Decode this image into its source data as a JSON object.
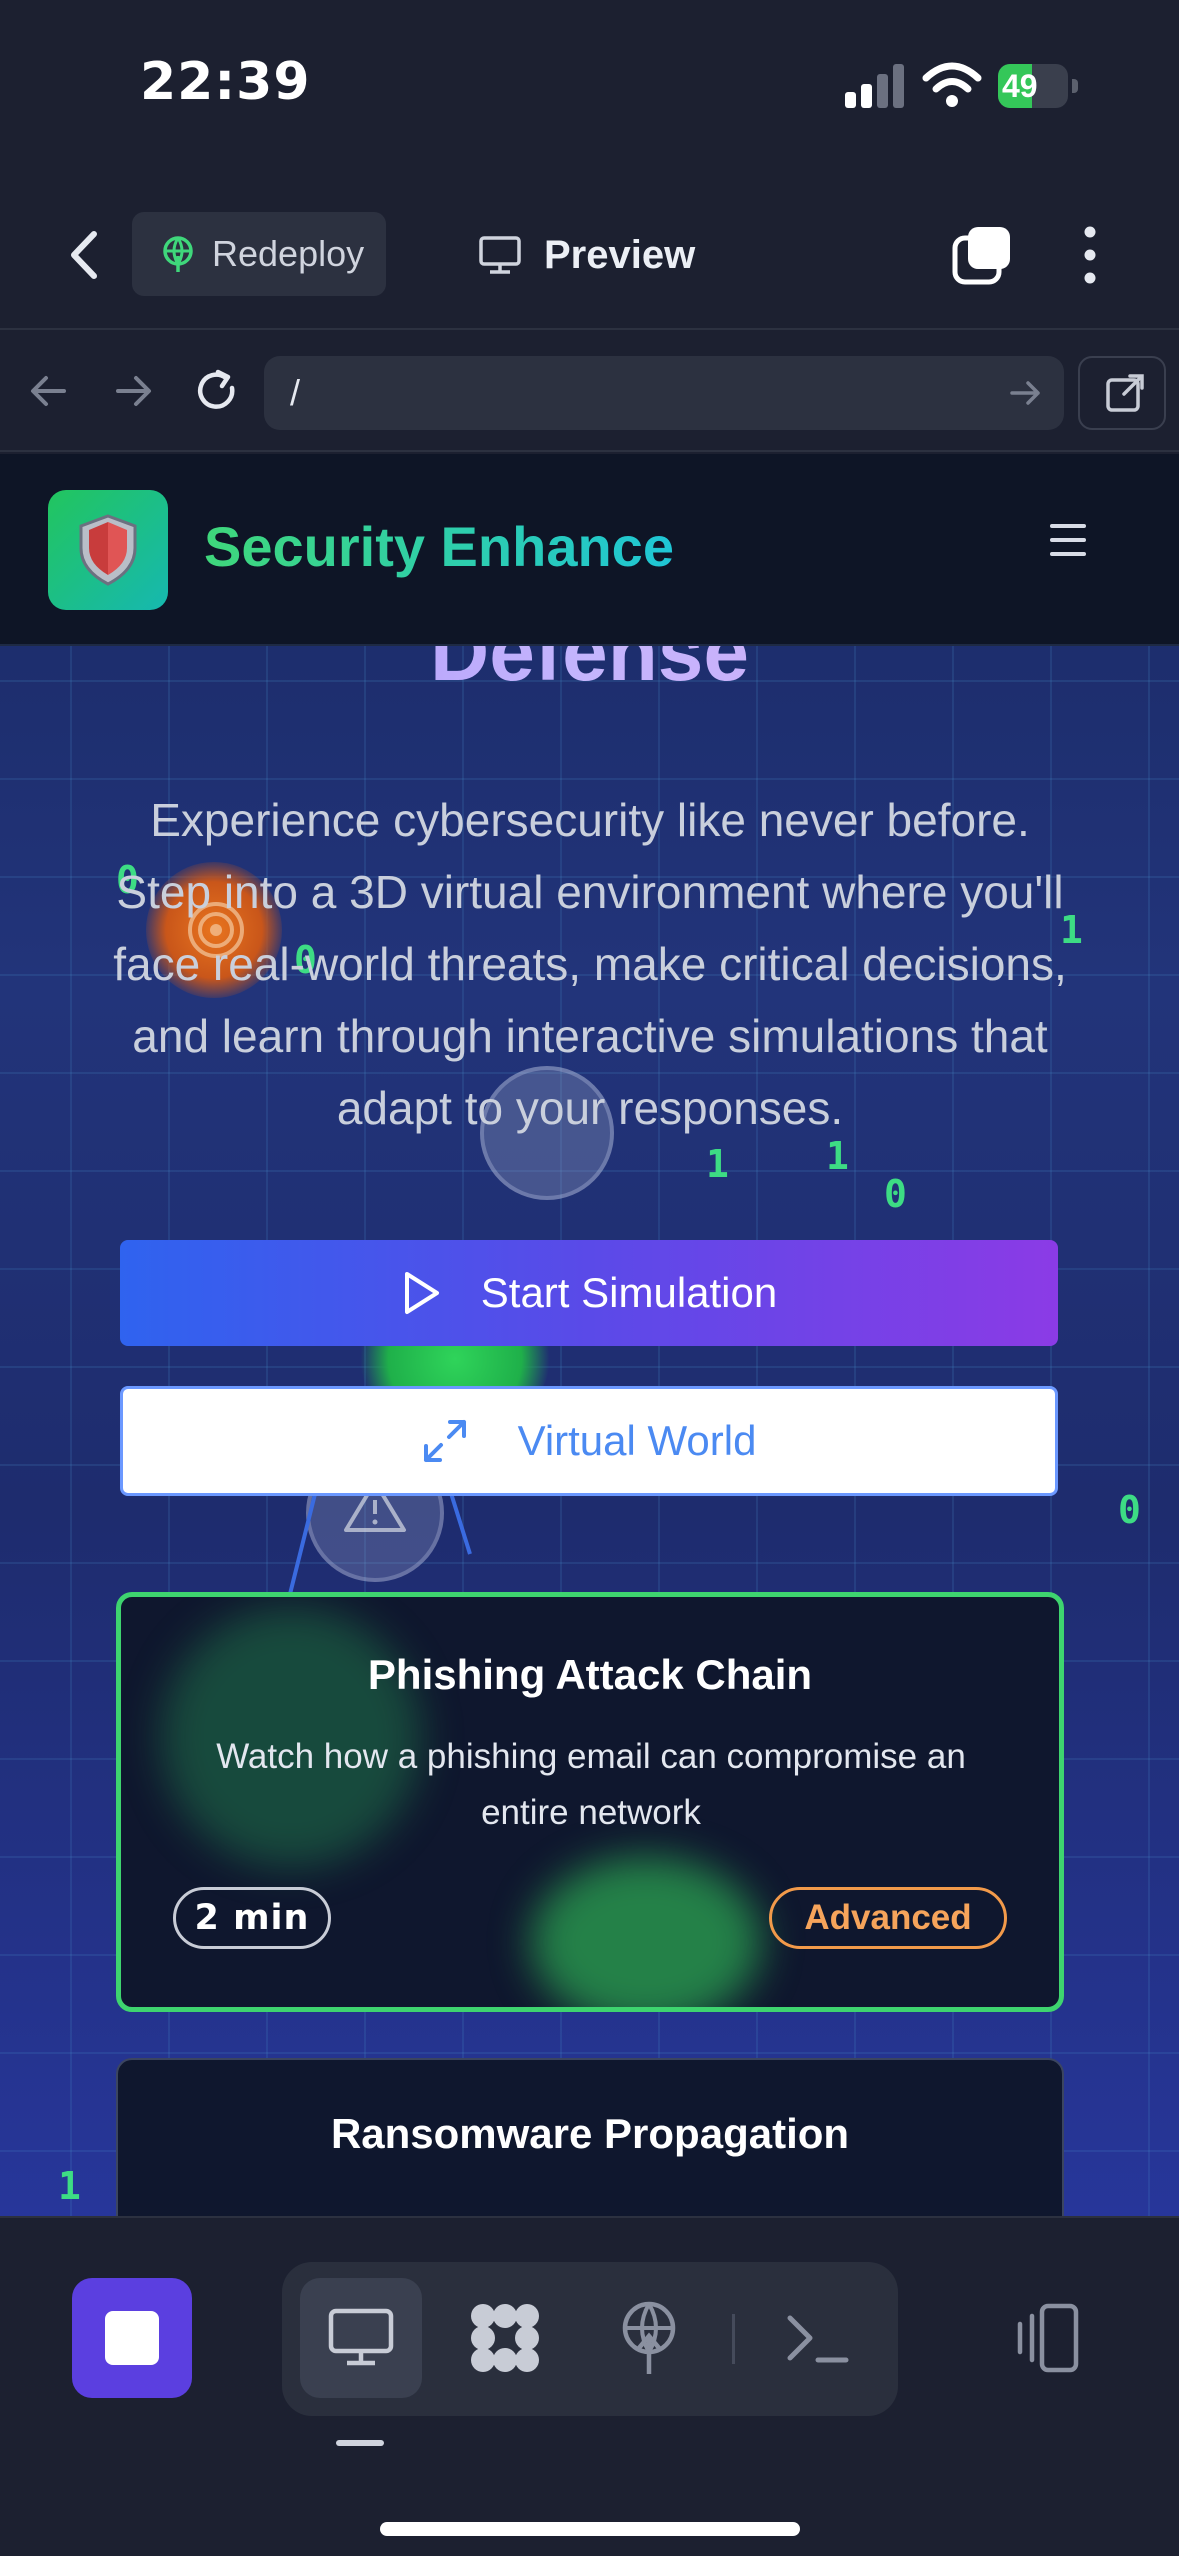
{
  "status_bar": {
    "time": "22:39",
    "battery": "49",
    "battery_level": 0.49
  },
  "toolbar": {
    "redeploy_label": "Redeploy",
    "preview_label": "Preview"
  },
  "address_bar": {
    "url": "/"
  },
  "site": {
    "brand": "Security Enhance",
    "hero_title": "Defense",
    "hero_description": "Experience cybersecurity like never before. Step into a 3D virtual environment where you'll face real-world threats, make critical decisions, and learn through interactive simulations that adapt to your responses.",
    "start_button": "Start Simulation",
    "virtual_world_button": "Virtual World",
    "cards": [
      {
        "title": "Phishing Attack Chain",
        "description": "Watch how a phishing email can compromise an entire network",
        "duration": "2 min",
        "level": "Advanced"
      },
      {
        "title": "Ransomware Propagation"
      }
    ],
    "binary_digits": [
      "0",
      "0",
      "1",
      "1",
      "1",
      "0",
      "0",
      "1"
    ]
  },
  "colors": {
    "brand_green": "#3fd77b",
    "brand_cyan": "#1fc6d6",
    "accent_purple": "#5b3fe0",
    "active_card_border": "#3ed46f",
    "level_orange": "#f29a4a"
  }
}
